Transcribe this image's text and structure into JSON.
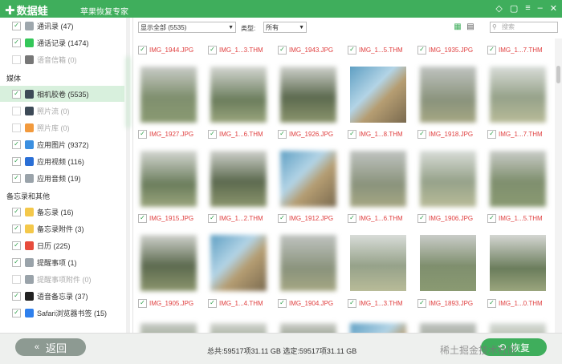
{
  "app": {
    "name": "数据蛙",
    "subtitle": "苹果恢复专家"
  },
  "window_icons": [
    "diamond-icon",
    "chat-icon",
    "menu-icon",
    "minimize-icon",
    "close-icon"
  ],
  "sidebar": {
    "top_items": [
      {
        "label": "通讯录 (47)",
        "checked": true,
        "icon": "contacts-icon",
        "color": "#9ea7ad"
      },
      {
        "label": "通话记录 (1474)",
        "checked": true,
        "icon": "phone-icon",
        "color": "#34c759"
      },
      {
        "label": "语音信箱 (0)",
        "checked": false,
        "icon": "voicemail-icon",
        "color": "#777777",
        "disabled": true
      }
    ],
    "media_header": "媒体",
    "media_items": [
      {
        "label": "相机胶卷 (5535)",
        "checked": true,
        "icon": "camera-icon",
        "color": "#3d4a57",
        "active": true
      },
      {
        "label": "照片流 (0)",
        "checked": false,
        "icon": "photostream-icon",
        "color": "#3d4a57",
        "disabled": true
      },
      {
        "label": "照片库 (0)",
        "checked": false,
        "icon": "photos-icon",
        "color": "#f29a3d",
        "disabled": true
      },
      {
        "label": "应用图片 (9372)",
        "checked": true,
        "icon": "app-photo-icon",
        "color": "#3b8fe0"
      },
      {
        "label": "应用视频 (116)",
        "checked": true,
        "icon": "app-video-icon",
        "color": "#2a6fd6"
      },
      {
        "label": "应用音频 (19)",
        "checked": true,
        "icon": "app-audio-icon",
        "color": "#9aa3aa"
      }
    ],
    "memo_header": "备忘录和其他",
    "memo_items": [
      {
        "label": "备忘录 (16)",
        "checked": true,
        "icon": "notes-icon",
        "color": "#f4c84a"
      },
      {
        "label": "备忘录附件 (3)",
        "checked": true,
        "icon": "notes-attachment-icon",
        "color": "#f4c84a"
      },
      {
        "label": "日历 (225)",
        "checked": true,
        "icon": "calendar-icon",
        "color": "#e74c3c"
      },
      {
        "label": "提醒事项 (1)",
        "checked": true,
        "icon": "reminders-icon",
        "color": "#9aa3aa"
      },
      {
        "label": "提醒事项附件 (0)",
        "checked": false,
        "icon": "reminders-attachment-icon",
        "color": "#9aa3aa",
        "disabled": true
      },
      {
        "label": "语音备忘录 (37)",
        "checked": true,
        "icon": "voice-memo-icon",
        "color": "#222222"
      },
      {
        "label": "Safari浏览器书签 (15)",
        "checked": true,
        "icon": "safari-icon",
        "color": "#2f80ed"
      }
    ]
  },
  "toolbar": {
    "filter_value": "显示全部 (5535)",
    "type_label": "类型:",
    "type_value": "所有",
    "search_placeholder": "搜索"
  },
  "grid": {
    "header_row": [
      "IMG_1944.JPG",
      "IMG_1...3.THM",
      "IMG_1943.JPG",
      "IMG_1...5.THM",
      "IMG_1935.JPG",
      "IMG_1...7.THM"
    ],
    "rows": [
      [
        "IMG_1927.JPG",
        "IMG_1...6.THM",
        "IMG_1926.JPG",
        "IMG_1...8.THM",
        "IMG_1918.JPG",
        "IMG_1...7.THM"
      ],
      [
        "IMG_1915.JPG",
        "IMG_1...2.THM",
        "IMG_1912.JPG",
        "IMG_1...6.THM",
        "IMG_1906.JPG",
        "IMG_1...5.THM"
      ],
      [
        "IMG_1905.JPG",
        "IMG_1...4.THM",
        "IMG_1904.JPG",
        "IMG_1...3.THM",
        "IMG_1893.JPG",
        "IMG_1...0.THM"
      ]
    ]
  },
  "footer": {
    "back_label": "返回",
    "status": "总共:59517项31.11 GB 选定:59517项31.11 GB",
    "recover_label": "恢复",
    "watermark": "稀土掘金技术社区"
  }
}
